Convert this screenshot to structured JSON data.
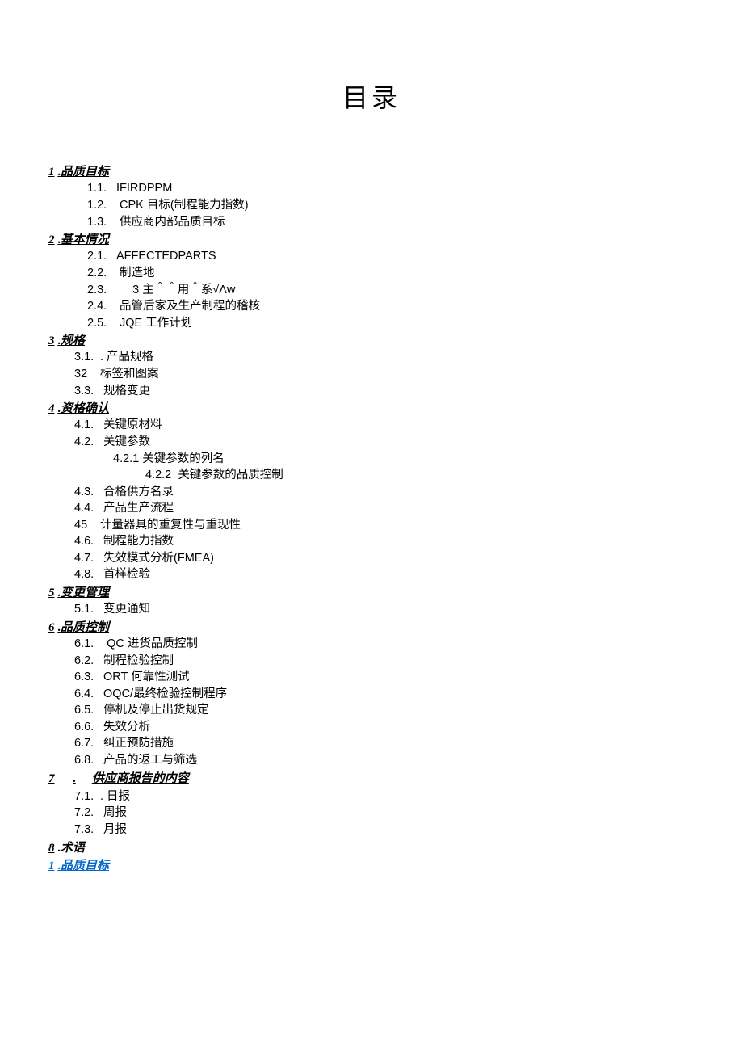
{
  "title": "目录",
  "sec1": {
    "num": "1",
    "dot": ".",
    "label": "品质目标",
    "i1": {
      "num": "1.1.",
      "label": "IFIRDPPM"
    },
    "i2": {
      "num": "1.2.",
      "label": "CPK 目标(制程能力指数)"
    },
    "i3": {
      "num": "1.3.",
      "label": "供应商内部品质目标"
    }
  },
  "sec2": {
    "num": "2",
    "dot": ".",
    "label": "基本情况",
    "i1": {
      "num": "2.1.",
      "label": "AFFECTEDPARTS"
    },
    "i2": {
      "num": "2.2.",
      "label": "制造地"
    },
    "i3": {
      "num": "2.3.",
      "label": "3 主＾＾用＾系√Λw"
    },
    "i4": {
      "num": "2.4.",
      "label": "品管后家及生产制程的稽核"
    },
    "i5": {
      "num": "2.5.",
      "label": "JQE 工作计划"
    }
  },
  "sec3": {
    "num": "3",
    "dot": ".",
    "label": "规格",
    "i1": {
      "num": "3.1.",
      "label": ". 产品规格"
    },
    "i2": {
      "num": "32",
      "label": "标签和图案"
    },
    "i3": {
      "num": "3.3.",
      "label": "规格变更"
    }
  },
  "sec4": {
    "num": "4",
    "dot": ".",
    "label": "资格确认",
    "i1": {
      "num": "4.1.",
      "label": "关键原材料"
    },
    "i2": {
      "num": "4.2.",
      "label": "关键参数"
    },
    "i21": {
      "num": "4.2.1",
      "label": "关键参数的列名"
    },
    "i22": {
      "num": "4.2.2",
      "label": "关键参数的品质控制"
    },
    "i3": {
      "num": "4.3.",
      "label": "合格供方名录"
    },
    "i4": {
      "num": "4.4.",
      "label": "产品生产流程"
    },
    "i5": {
      "num": "45",
      "label": "计量器具的重复性与重现性"
    },
    "i6": {
      "num": "4.6.",
      "label": "制程能力指数"
    },
    "i7": {
      "num": "4.7.",
      "label": "失效模式分析(FMEA)"
    },
    "i8": {
      "num": "4.8.",
      "label": "首样检验"
    }
  },
  "sec5": {
    "num": "5",
    "dot": ".",
    "label": "变更管理",
    "i1": {
      "num": "5.1.",
      "label": "变更通知"
    }
  },
  "sec6": {
    "num": "6",
    "dot": ".",
    "label": "品质控制",
    "i1": {
      "num": "6.1.",
      "label": "QC 进货品质控制"
    },
    "i2": {
      "num": "6.2.",
      "label": "制程检验控制"
    },
    "i3": {
      "num": "6.3.",
      "label": "ORT 何靠性测试"
    },
    "i4": {
      "num": "6.4.",
      "label": "OQC/最终检验控制程序"
    },
    "i5": {
      "num": "6.5.",
      "label": "停机及停止出货规定"
    },
    "i6": {
      "num": "6.6.",
      "label": "失效分析"
    },
    "i7": {
      "num": "6.7.",
      "label": "纠正预防措施"
    },
    "i8": {
      "num": "6.8.",
      "label": "产品的返工与筛选"
    }
  },
  "sec7": {
    "num": "7",
    "dot": ".",
    "label": "供应商报告的内容",
    "i1": {
      "num": "7.1.",
      "label": ". 日报"
    },
    "i2": {
      "num": "7.2.",
      "label": "周报"
    },
    "i3": {
      "num": "7.3.",
      "label": "月报"
    }
  },
  "sec8": {
    "num": "8",
    "dot": ".",
    "label": "术语"
  },
  "repeat1": {
    "num": "1",
    "dot": ".",
    "label": "品质目标"
  }
}
